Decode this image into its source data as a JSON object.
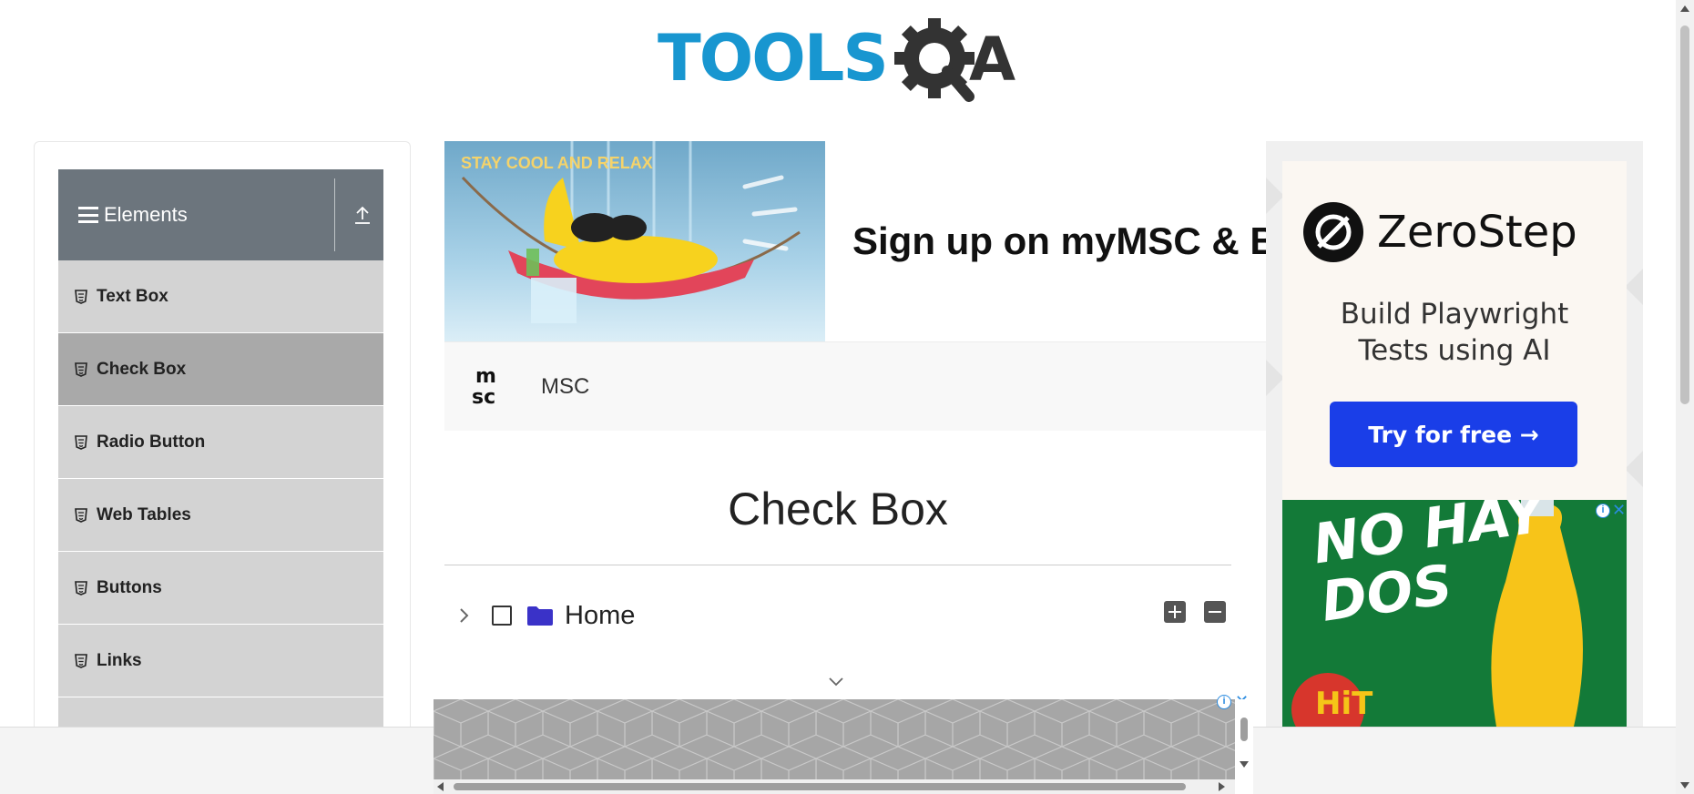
{
  "header": {
    "logo_alt": "TOOLSQA"
  },
  "sidebar": {
    "group_title": "Elements",
    "items": [
      {
        "label": "Text Box",
        "active": false
      },
      {
        "label": "Check Box",
        "active": true
      },
      {
        "label": "Radio Button",
        "active": false
      },
      {
        "label": "Web Tables",
        "active": false
      },
      {
        "label": "Buttons",
        "active": false
      },
      {
        "label": "Links",
        "active": false
      },
      {
        "label": "",
        "active": false
      }
    ]
  },
  "ad_top": {
    "banner_text": "STAY COOL AND RELAX",
    "headline": "Sign up on myMSC & B",
    "advertiser": "MSC"
  },
  "main": {
    "title": "Check Box",
    "tree": {
      "root_label": "Home",
      "expanded": false,
      "checked": false
    }
  },
  "ad_right": {
    "brand": "ZeroStep",
    "tagline_line1": "Build Playwright",
    "tagline_line2": "Tests using AI",
    "cta": "Try for free →",
    "juice_headline_line1": "NO HAY",
    "juice_headline_line2": "DOS",
    "juice_brand": "HiT"
  },
  "ad_controls": {
    "close_glyph": "✕",
    "info_glyph": "i"
  },
  "colors": {
    "brand_blue": "#1896d0",
    "brand_dark": "#333333",
    "sidebar_header": "#6c757d",
    "sidebar_item": "#d3d3d3",
    "sidebar_item_active": "#a9a9a9",
    "folder_icon": "#3a32c8",
    "cta_blue": "#1a3ee8"
  }
}
